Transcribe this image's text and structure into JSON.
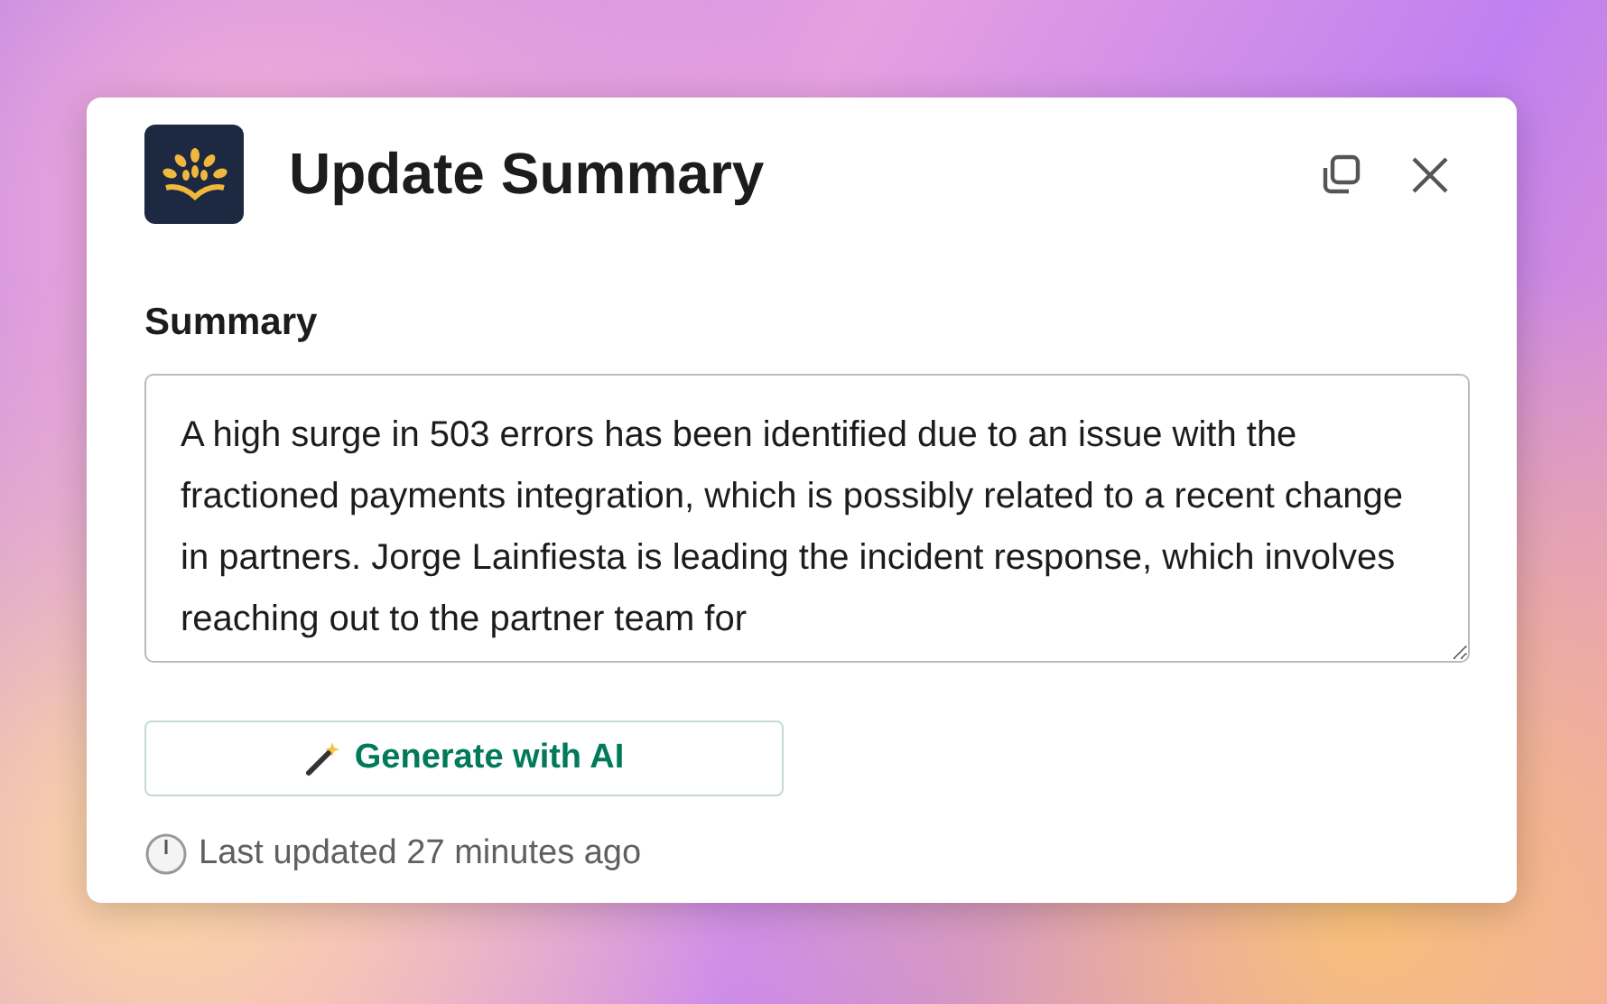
{
  "dialog": {
    "title": "Update Summary"
  },
  "summary": {
    "label": "Summary",
    "value": "A high surge in 503 errors has been identified due to an issue with the fractioned payments integration, which is possibly related to a recent change in partners. Jorge Lainfiesta is leading the incident response, which involves reaching out to the partner team for"
  },
  "generate_button": {
    "label": "Generate with AI"
  },
  "last_updated": "Last updated 27 minutes ago"
}
